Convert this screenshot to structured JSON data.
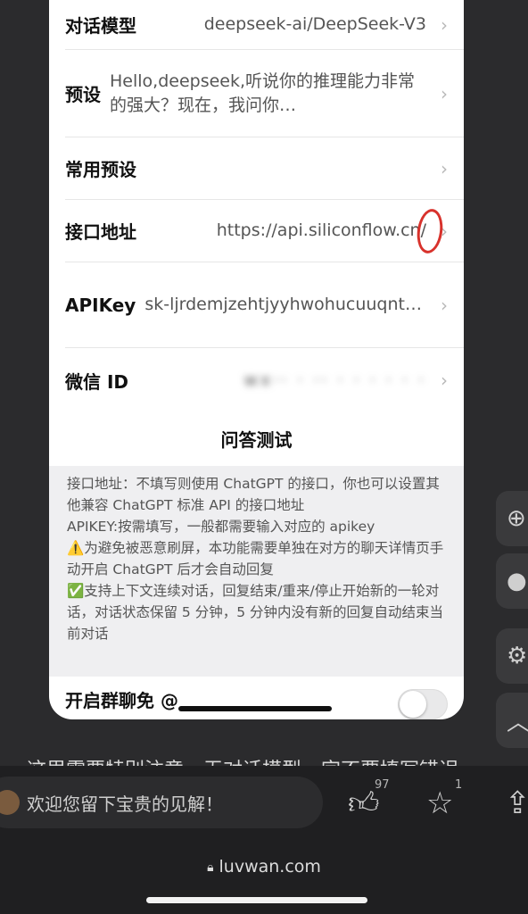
{
  "settings": {
    "rows": [
      {
        "label": "对话模型",
        "value": "deepseek-ai/DeepSeek-V3"
      },
      {
        "label": "预设",
        "value": "Hello,deepseek,听说你的推理能力非常的强大？现在，我问你…"
      },
      {
        "label": "常用预设",
        "value": ""
      },
      {
        "label": "接口地址",
        "value": "https://api.siliconflow.cn/"
      },
      {
        "label": "APIKey",
        "value": "sk-ljrdemjzehtjyyhwohucuuqnt…"
      },
      {
        "label": "微信 ID",
        "value": "wx·· ·  ·· · · · ·  · ·"
      }
    ],
    "test_button": "问答测试",
    "notes": [
      "接口地址：不填写则使用 ChatGPT 的接口，你也可以设置其他兼容 ChatGPT 标准 API 的接口地址",
      "APIKEY:按需填写，一般都需要输入对应的 apikey",
      "⚠️为避免被恶意刷屏，本功能需要单独在对方的聊天详情页手动开启 ChatGPT 后才会自动回复",
      "✅支持上下文连续对话，回复结束/重来/停止开始新的一轮对话，对话状态保留 5 分钟，5 分钟内没有新的回复自动结束当前对话"
    ],
    "group_label": "开启群聊免 @",
    "group_toggle_on": false
  },
  "article_text": "这里需要特别注意，无对话模型，字不要填写错误",
  "comment_bar": {
    "placeholder": "欢迎您留下宝贵的见解！",
    "like_count": "97",
    "star_count": "1"
  },
  "browser": {
    "url": "luvwan.com"
  },
  "icons": {
    "chevron": "chevron-right-icon",
    "like": "thumbs-up-icon",
    "star": "star-icon",
    "share": "share-icon",
    "lock": "lock-icon"
  },
  "colors": {
    "background": "#2b2b2d",
    "card": "#ffffff",
    "notes_bg": "#efeff1",
    "annotation_red": "#d8322c"
  }
}
